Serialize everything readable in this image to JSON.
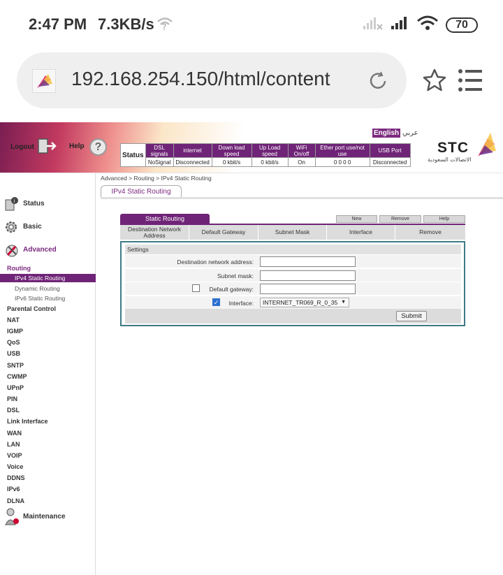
{
  "statusbar": {
    "time": "2:47 PM",
    "speed": "7.3KB/s",
    "battery": "70"
  },
  "browser": {
    "url": "192.168.254.150/html/content"
  },
  "header": {
    "logout": "Logout",
    "help": "Help",
    "lang_en": "English",
    "lang_ar": "عربي",
    "brand": "STC",
    "brand_ar": "الاتصالات السعودية"
  },
  "status_table": {
    "label": "Status",
    "headers": [
      "DSL signals",
      "internet",
      "Down load speed",
      "Up Load speed",
      "WiFi On/off",
      "Ether port use/not use",
      "USB Port"
    ],
    "values": [
      "NoSignal",
      "Disconnected",
      "0 kbit/s",
      "0 kbit/s",
      "On",
      "0 0 0 0",
      "Disconnected"
    ]
  },
  "nav": {
    "status": "Status",
    "basic": "Basic",
    "advanced": "Advanced",
    "routing": "Routing",
    "routing_items": [
      "IPv4 Static Routing",
      "Dynamic Routing",
      "IPv6 Static Routing"
    ],
    "items": [
      "Parental Control",
      "NAT",
      "IGMP",
      "QoS",
      "USB",
      "SNTP",
      "CWMP",
      "UPnP",
      "PIN",
      "DSL",
      "Link Interface",
      "WAN",
      "LAN",
      "VOIP",
      "Voice",
      "DDNS",
      "IPv6",
      "DLNA"
    ],
    "maintenance": "Maintenance"
  },
  "main": {
    "breadcrumb": "Advanced > Routing > IPv4 Static Routing",
    "tab": "IPv4 Static Routing",
    "panel_title": "Static Routing",
    "buttons": {
      "new": "New",
      "remove": "Remove",
      "help": "Help"
    },
    "columns": [
      "Destination Network Address",
      "Default Gateway",
      "Subnet Mask",
      "Interface",
      "Remove"
    ],
    "settings": {
      "title": "Settings",
      "dest_label": "Destination network address:",
      "mask_label": "Subnet mask:",
      "gateway_label": "Default gateway:",
      "interface_label": "Interface:",
      "interface_value": "INTERNET_TR069_R_0_35",
      "submit": "Submit"
    }
  }
}
